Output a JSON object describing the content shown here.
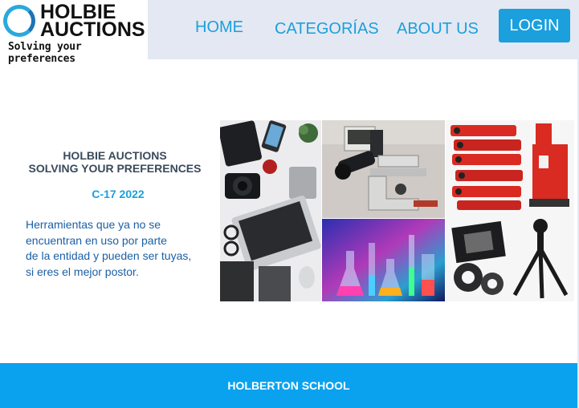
{
  "logo": {
    "line1": "HOLBIE",
    "line2": "AUCTIONS",
    "tagline": "Solving your preferences"
  },
  "nav": {
    "home": "HOME",
    "categories": "CATEGORÍAS",
    "about": "ABOUT US",
    "login": "LOGIN"
  },
  "hero": {
    "title_line1": "HOLBIE AUCTIONS",
    "title_line2": "SOLVING YOUR PREFERENCES",
    "code": "C-17 2022",
    "desc_lines": [
      "Herramientas que ya no se",
      "encuentran en uso por parte",
      "de la entidad y pueden ser tuyas,",
      "si eres el mejor postor."
    ]
  },
  "collage": {
    "tiles": [
      {
        "name": "laptop-camera-tech-image"
      },
      {
        "name": "microscope-image"
      },
      {
        "name": "lab-glassware-image"
      },
      {
        "name": "hydraulic-tools-tripod-image"
      }
    ]
  },
  "footer": {
    "text": "HOLBERTON SCHOOL"
  },
  "colors": {
    "accent": "#1b9fdd",
    "header_bg": "#e4e8f2",
    "footer_bg": "#0aa2ef",
    "hero_title": "#3a4a5c",
    "hero_desc": "#1a5fa6"
  }
}
